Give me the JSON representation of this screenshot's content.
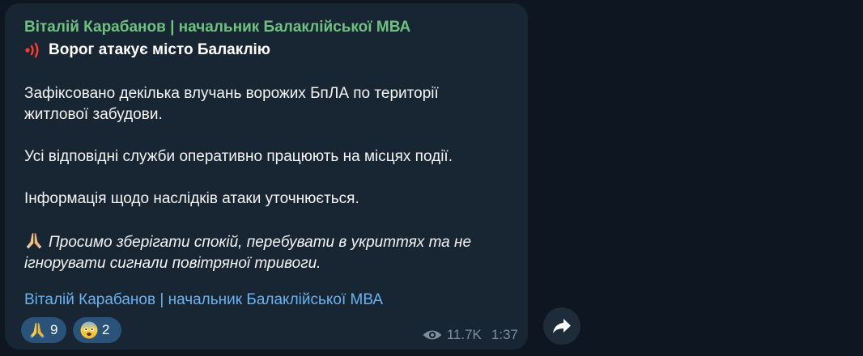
{
  "message": {
    "author": "Віталій Карабанов | начальник Балаклійської МВА",
    "headline": "Ворог атакує місто Балаклію",
    "paragraphs": [
      [
        "Зафіксовано декілька влучань ворожих БпЛА по території",
        "житлової забудови."
      ],
      [
        "Усі відповідні служби оперативно працюють на місцях події."
      ],
      [
        "Інформація щодо наслідків атаки уточнюється."
      ]
    ],
    "italic_note": [
      "Просимо зберігати спокій, перебувати в укриттях та не",
      "ігнорувати сигнали повітряної тривоги."
    ],
    "signature": "Віталій Карабанов | начальник Балаклійської МВА",
    "icons": {
      "headline": "siren-icon",
      "note": "folded-hands-emoji"
    }
  },
  "reactions": [
    {
      "emoji": "folded-hands-emoji",
      "count": "9"
    },
    {
      "emoji": "fearful-face-emoji",
      "count": "2"
    }
  ],
  "meta": {
    "views_icon": "eye-icon",
    "views": "11.7K",
    "time": "1:37"
  },
  "actions": {
    "forward_icon": "forward-arrow-icon"
  },
  "colors": {
    "background": "#0e1621",
    "bubble": "#182533",
    "author": "#6fc181",
    "link": "#6ab3f3",
    "reaction_bg": "#2b5278",
    "meta": "#7d8e9e"
  }
}
